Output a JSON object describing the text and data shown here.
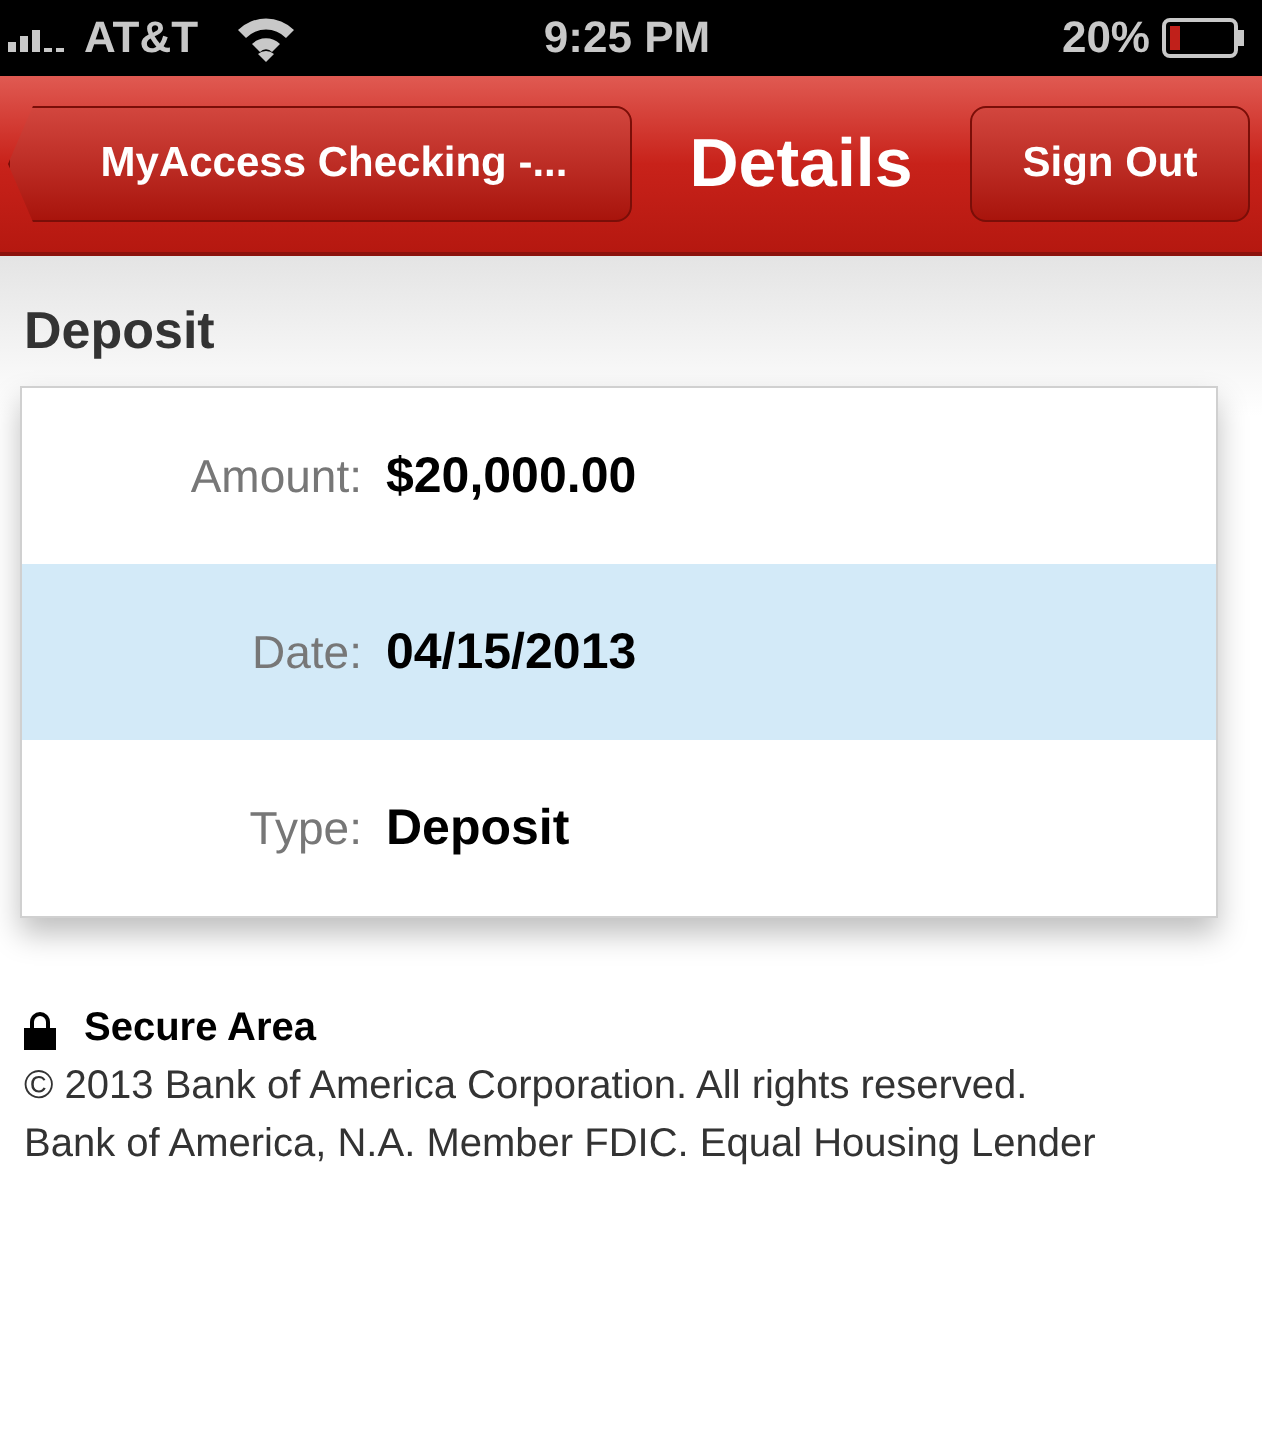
{
  "status_bar": {
    "carrier": "AT&T",
    "time": "9:25 PM",
    "battery": "20%"
  },
  "nav_bar": {
    "back_button": "MyAccess Checking -...",
    "title": "Details",
    "action_button": "Sign Out"
  },
  "section_title": "Deposit",
  "rows": [
    {
      "label": "Amount:",
      "value": "$20,000.00",
      "selected": false
    },
    {
      "label": "Date:",
      "value": "04/15/2013",
      "selected": true
    },
    {
      "label": "Type:",
      "value": "Deposit",
      "selected": false
    }
  ],
  "footer": {
    "secure_label": "Secure Area",
    "lines": [
      "© 2013  Bank of America Corporation. All rights reserved.",
      "Bank of America, N.A. Member FDIC. Equal Housing Lender"
    ]
  }
}
